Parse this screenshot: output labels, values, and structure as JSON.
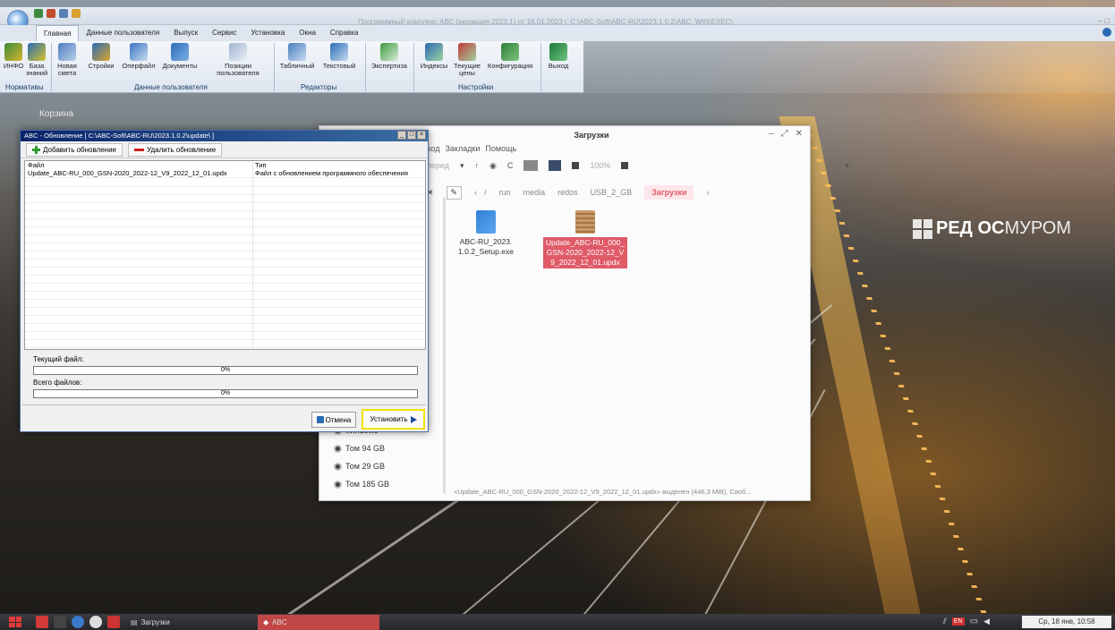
{
  "app": {
    "title": "Программный комплекс АВС (редакция 2023.1) от 16.01.2023 г.     C:\\ABC-Soft\\ABC-RU\\2023.1.0.2\\ABC_WIN\\EXEC\\",
    "tabs": [
      "Главная",
      "Данные пользователя",
      "Выпуск",
      "Сервис",
      "Установка",
      "Окна",
      "Справка"
    ],
    "ribbon_buttons": [
      {
        "label": "ИНФО",
        "icon": "info-icon"
      },
      {
        "label": "База знаний",
        "icon": "knowledge-base-icon"
      },
      {
        "label": "Новая смета",
        "icon": "new-estimate-icon"
      },
      {
        "label": "Стройки",
        "icon": "construction-icon"
      },
      {
        "label": "Оперфайл",
        "icon": "operfile-icon"
      },
      {
        "label": "Документы",
        "icon": "documents-icon"
      },
      {
        "label": "Позиции пользователя",
        "icon": "user-positions-icon"
      },
      {
        "label": "Табличный",
        "icon": "table-editor-icon"
      },
      {
        "label": "Текстовый",
        "icon": "text-editor-icon"
      },
      {
        "label": "Экспертиза",
        "icon": "expertise-icon"
      },
      {
        "label": "Индексы",
        "icon": "indexes-icon"
      },
      {
        "label": "Текущие цены",
        "icon": "current-prices-icon"
      },
      {
        "label": "Конфигурация",
        "icon": "configuration-icon"
      },
      {
        "label": "Выход",
        "icon": "exit-icon"
      }
    ],
    "groups": [
      "Нормативы",
      "Данные пользователя",
      "Редакторы",
      "Настройки"
    ]
  },
  "desktop": {
    "icon_label": "Корзина",
    "brand_bold": "РЕД ОС",
    "brand_light": "МУРОМ"
  },
  "dialog": {
    "title": "ABC - Обновление [ C:\\ABC-Soft\\ABC-RU\\2023.1.0.2\\update\\ ]",
    "add_label": "Добавить обновление",
    "remove_label": "Удалить обновление",
    "col_file": "Файл",
    "col_type": "Тип",
    "rows": [
      {
        "file": "Update_ABC-RU_000_GSN-2020_2022-12_V9_2022_12_01.updx",
        "type": "Файл с обновлением программного обеспечения"
      }
    ],
    "current_file_label": "Текущий файл:",
    "current_progress": "0%",
    "total_files_label": "Всего файлов:",
    "total_progress": "0%",
    "cancel_label": "Отмена",
    "install_label": "Установить"
  },
  "filemanager": {
    "title": "Загрузки",
    "menu": [
      "ход",
      "Закладки",
      "Помощь"
    ],
    "nav_back": "перед",
    "zoom": "100%",
    "path": [
      "/",
      "run",
      "media",
      "redos",
      "USB_2_GB",
      "Загрузки"
    ],
    "sidebar": [
      "Windows",
      "Том 94 GB",
      "Том 29 GB",
      "Том 185 GB"
    ],
    "files": [
      {
        "name": "ABC-RU_2023.1.0.2_Setup.exe",
        "selected": false
      },
      {
        "name": "Update_ABC-RU_000_GSN-2020_2022-12_V9_2022_12_01.updx",
        "selected": true
      }
    ],
    "status": "«Update_ABC-RU_000_GSN-2020_2022-12_V9_2022_12_01.updx» выделен (446,3 MiB), Своб..."
  },
  "taskbar": {
    "task_files": "Загрузки",
    "task_abc": "ABC",
    "lang": "EN",
    "clock": "Ср, 18 янв, 10:58"
  },
  "colors": {
    "accent_selected": "#e05a67",
    "install_highlight": "#f2e20a"
  }
}
